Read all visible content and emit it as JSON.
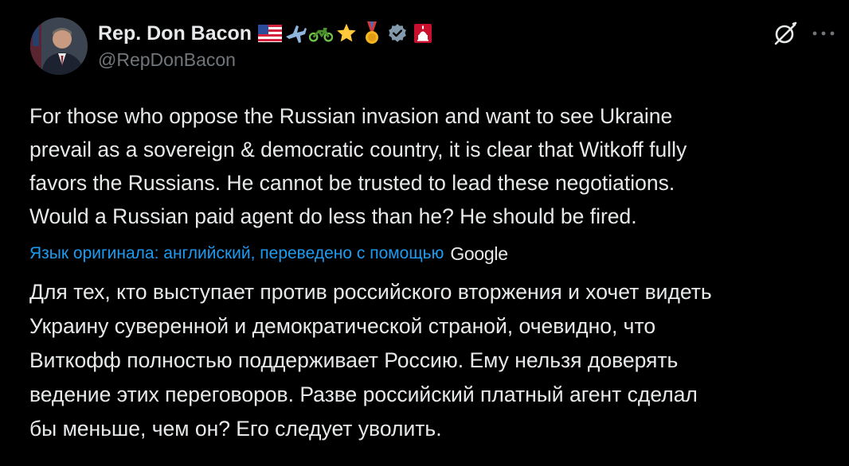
{
  "author": {
    "display_name": "Rep. Don Bacon",
    "handle": "@RepDonBacon",
    "badges": [
      "us-flag-icon",
      "airplane-icon",
      "motorcycle-icon",
      "star-icon",
      "medal-icon",
      "verified-badge-icon",
      "capitol-icon"
    ]
  },
  "actions": {
    "grok": "grok-icon",
    "more": "more-options-icon"
  },
  "tweet": {
    "text": "For those who oppose the Russian invasion and want to see Ukraine\nprevail as a sovereign & democratic country, it is clear that Witkoff fully\nfavors the Russians. He cannot be trusted to lead these negotiations.\nWould a Russian paid agent do less than he? He should be fired."
  },
  "translation": {
    "label": "Язык оригинала: английский, переведено с помощью",
    "provider": "Google",
    "text": "Для тех, кто выступает против российского вторжения и хочет видеть\nУкраину суверенной и демократической страной, очевидно, что\nВиткофф полностью поддерживает Россию. Ему нельзя доверять\nведение этих переговоров. Разве российский платный агент сделал\nбы меньше, чем он? Его следует уволить."
  },
  "colors": {
    "background": "#000000",
    "text_primary": "#e7e9ea",
    "text_secondary": "#71767b",
    "link": "#1d9bf0",
    "verified_badge": "#829aab"
  }
}
